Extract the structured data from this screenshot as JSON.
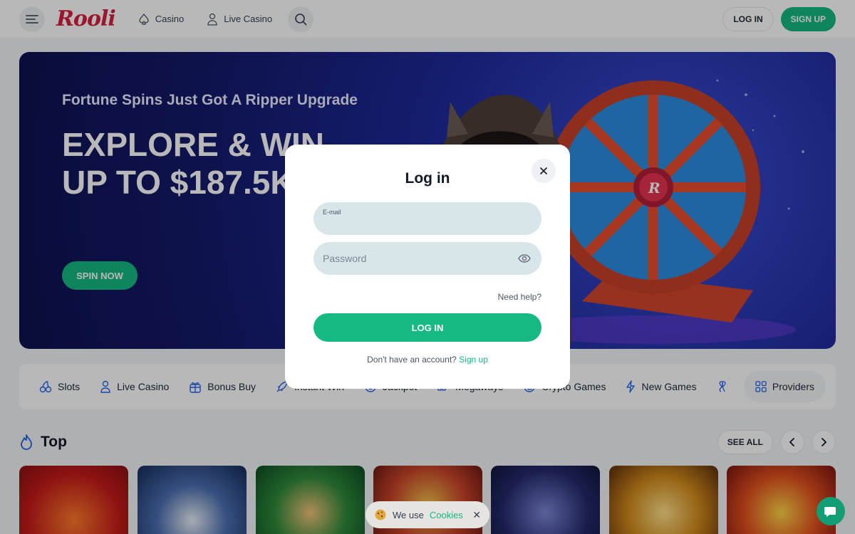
{
  "header": {
    "logo": "Rooli",
    "nav": [
      {
        "label": "Casino",
        "icon": "spade-icon"
      },
      {
        "label": "Live Casino",
        "icon": "dealer-icon"
      }
    ],
    "login_label": "LOG IN",
    "signup_label": "SIGN UP"
  },
  "hero": {
    "subtitle": "Fortune Spins Just Got A Ripper Upgrade",
    "title": "EXPLORE & WIN UP TO $187.5K",
    "cta": "SPIN NOW"
  },
  "categories": [
    {
      "label": "Slots",
      "icon": "cherries-icon"
    },
    {
      "label": "Live Casino",
      "icon": "dealer-icon"
    },
    {
      "label": "Bonus Buy",
      "icon": "gift-icon"
    },
    {
      "label": "Instant Win",
      "icon": "rocket-icon"
    },
    {
      "label": "Jackpot",
      "icon": "coin-icon"
    },
    {
      "label": "Megaways",
      "icon": "ways-icon"
    },
    {
      "label": "Crypto Games",
      "icon": "crypto-icon"
    },
    {
      "label": "New Games",
      "icon": "lightning-icon"
    },
    {
      "label": "",
      "icon": "clover-icon"
    },
    {
      "label": "Providers",
      "icon": "grid-icon"
    }
  ],
  "top": {
    "title": "Top",
    "see_all": "SEE ALL"
  },
  "modal": {
    "title": "Log in",
    "email_label": "E-mail",
    "email_value": "",
    "password_placeholder": "Password",
    "need_help": "Need help?",
    "login_button": "LOG IN",
    "no_account": "Don't have an account?",
    "signup_link": "Sign up"
  },
  "cookie": {
    "text": "We use",
    "link": "Cookies"
  },
  "colors": {
    "accent": "#16b981",
    "brand": "#d61f3f"
  }
}
